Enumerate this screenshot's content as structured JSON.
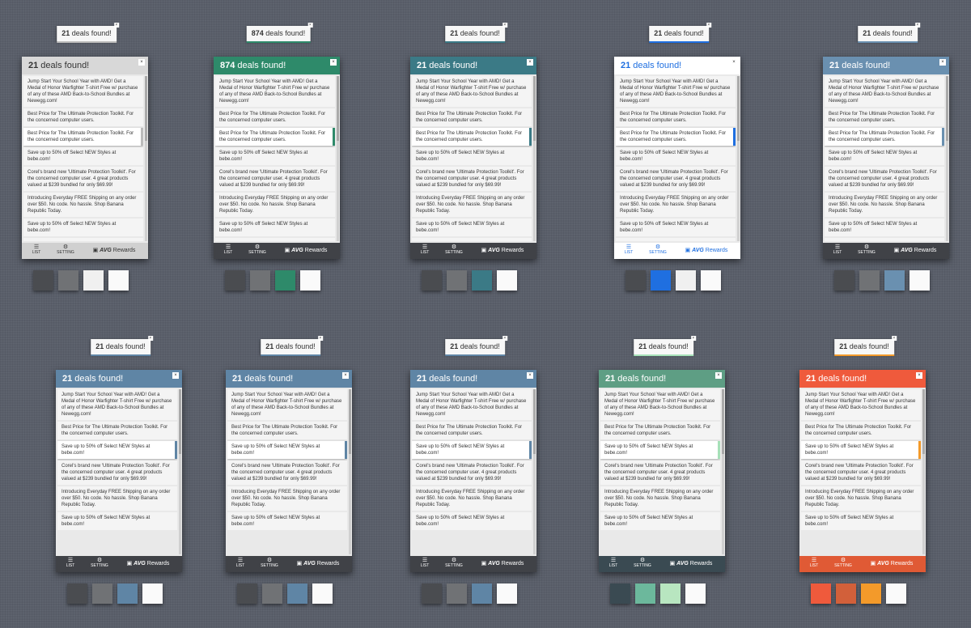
{
  "window": {
    "background": "#5a5f6a"
  },
  "common": {
    "list_label": "LIST",
    "setting_label": "SETTING",
    "avg_label": "AVG",
    "rewards_label": "Rewards",
    "close_glyph": "×",
    "deals_count_suffix": "deals found!",
    "icons": {
      "list": "list-icon",
      "setting": "gear-icon",
      "logo": "avg-logo-icon",
      "close": "close-icon"
    }
  },
  "deals": [
    "Jump Start Your School Year with AMD! Get a Medal of Honor Warfighter T-shirt Free w/ purchase of any of these AMD Back-to-School Bundles at Newegg.com!",
    "Best Price for The Ultimate Protection Toolkit. For the concerned computer users.",
    "Best Price for The Ultimate Protection Toolkit. For the concerned computer users.",
    "Save up to 50% off Select NEW Styles at bebe.com!",
    "Corel's brand new 'Ultimate Protection Toolkit'. For the concerned computer user. 4 great products valued at $239 bundled for only $69.99!",
    "Introducing Everyday FREE Shipping on any order over $50. No code. No hassle. Shop Banana Republic Today.",
    "Save up to 50% off Select NEW Styles at bebe.com!",
    "Corel's brand new 'Ultimate Protection Toolkit'."
  ],
  "deals_alt": [
    "Jump Start Your School Year with AMD! Get a Medal of Honor Warfighter T-shirt Free w/ purchase of any of these AMD Back-to-School Bundles at Newegg.com!",
    "Best Price for The Ultimate Protection Toolkit. For the concerned computer users.",
    "Save up to 50% off Select NEW Styles at bebe.com!",
    "Corel's brand new 'Ultimate Protection Toolkit'. For the concerned computer user. 4 great products valued at $239 bundled for only $69.99!",
    "Introducing Everyday FREE Shipping on any order over $50. No code. No hassle. Shop Banana Republic Today.",
    "Save up to 50% off Select NEW Styles at bebe.com!"
  ],
  "variants": [
    {
      "count": "21",
      "header_bg": "#d8d8d8",
      "header_text": "#333333",
      "footer_bg": "#d0d0d0",
      "footer_text": "#333333",
      "accent": "#bbbbbb",
      "selected_index": 2,
      "deal_set": "deals",
      "swatches": [
        "#4a4c50",
        "#707275",
        "#f0f0f0",
        "#fafafa"
      ]
    },
    {
      "count": "874",
      "header_bg": "#2e8a6a",
      "header_text": "#ffffff",
      "footer_bg": "#404247",
      "footer_text": "#ffffff",
      "accent": "#2e8a6a",
      "selected_index": 2,
      "deal_set": "deals",
      "swatches": [
        "#4a4c50",
        "#707275",
        "#2e8a6a",
        "#fafafa"
      ]
    },
    {
      "count": "21",
      "header_bg": "#3b7a86",
      "header_text": "#ffffff",
      "footer_bg": "#404247",
      "footer_text": "#ffffff",
      "accent": "#3b7a86",
      "selected_index": 2,
      "deal_set": "deals",
      "swatches": [
        "#4a4c50",
        "#707275",
        "#3b7a86",
        "#fafafa"
      ]
    },
    {
      "count": "21",
      "header_bg": "#ffffff",
      "header_text": "#1f6fe0",
      "footer_bg": "#ffffff",
      "footer_text": "#1f6fe0",
      "accent": "#1f6fe0",
      "selected_index": 2,
      "deal_set": "deals",
      "swatches": [
        "#4a4c50",
        "#1f6fe0",
        "#f0f0f0",
        "#fafafa"
      ]
    },
    {
      "count": "21",
      "header_bg": "#6a90b0",
      "header_text": "#ffffff",
      "footer_bg": "#404247",
      "footer_text": "#ffffff",
      "accent": "#6a90b0",
      "selected_index": 2,
      "deal_set": "deals",
      "swatches": [
        "#4a4c50",
        "#707275",
        "#6a90b0",
        "#fafafa"
      ]
    },
    {
      "count": "21",
      "header_bg": "#5f85a5",
      "header_text": "#ffffff",
      "footer_bg": "#404247",
      "footer_text": "#ffffff",
      "accent": "#5f85a5",
      "selected_index": 2,
      "deal_set": "deals_alt",
      "swatches": [
        "#4a4c50",
        "#707275",
        "#5f85a5",
        "#fafafa"
      ]
    },
    {
      "count": "21",
      "header_bg": "#5f85a5",
      "header_text": "#ffffff",
      "footer_bg": "#404247",
      "footer_text": "#ffffff",
      "accent": "#5f85a5",
      "selected_index": 2,
      "deal_set": "deals_alt",
      "swatches": [
        "#4a4c50",
        "#707275",
        "#5f85a5",
        "#fafafa"
      ]
    },
    {
      "count": "21",
      "header_bg": "#5f85a5",
      "header_text": "#ffffff",
      "footer_bg": "#404247",
      "footer_text": "#ffffff",
      "accent": "#5f85a5",
      "selected_index": 2,
      "deal_set": "deals_alt",
      "swatches": [
        "#4a4c50",
        "#707275",
        "#5f85a5",
        "#fafafa"
      ]
    },
    {
      "count": "21",
      "header_bg": "#5e9e84",
      "header_text": "#ffffff",
      "footer_bg": "#3a4a52",
      "footer_text": "#ffffff",
      "accent": "#a6e0b8",
      "selected_index": 2,
      "deal_set": "deals_alt",
      "swatches": [
        "#3a4a52",
        "#6cb89c",
        "#b8e6c0",
        "#fafafa"
      ]
    },
    {
      "count": "21",
      "header_bg": "#ef5a3c",
      "header_text": "#ffffff",
      "footer_bg": "#e05a35",
      "footer_text": "#ffffff",
      "accent": "#f39a2a",
      "selected_index": 2,
      "deal_set": "deals_alt",
      "swatches": [
        "#ef5a3c",
        "#d2603a",
        "#f39a2a",
        "#fafafa"
      ]
    }
  ]
}
